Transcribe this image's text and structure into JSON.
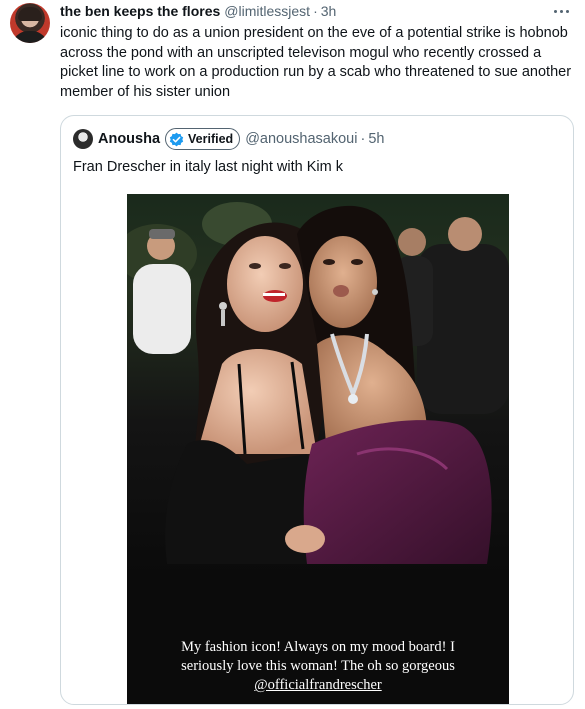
{
  "tweet": {
    "author_name": "the ben keeps the flores",
    "handle": "@limitlessjest",
    "time": "3h",
    "avatar_icon": "user-avatar",
    "more_icon": "more-options",
    "text": "iconic thing to do as a union president on the eve of a potential strike is hobnob across the pond with an unscripted televison mogul who recently crossed a picket line to work on a production run by a scab who threatened to sue another member of his sister union"
  },
  "quote": {
    "author_name": "Anousha",
    "verified_label": "Verified",
    "handle": "@anoushasakoui",
    "time": "5h",
    "text": "Fran Drescher in italy last night with Kim k",
    "image": {
      "caption_lines": [
        "My fashion icon! Always on my mood board! I",
        "seriously love this woman! The oh so gorgeous"
      ],
      "caption_link": "@officialfrandrescher"
    }
  },
  "colors": {
    "text_primary": "#0f1419",
    "text_secondary": "#536471",
    "border": "#cfd9de",
    "verified_blue": "#1d9bf0"
  }
}
